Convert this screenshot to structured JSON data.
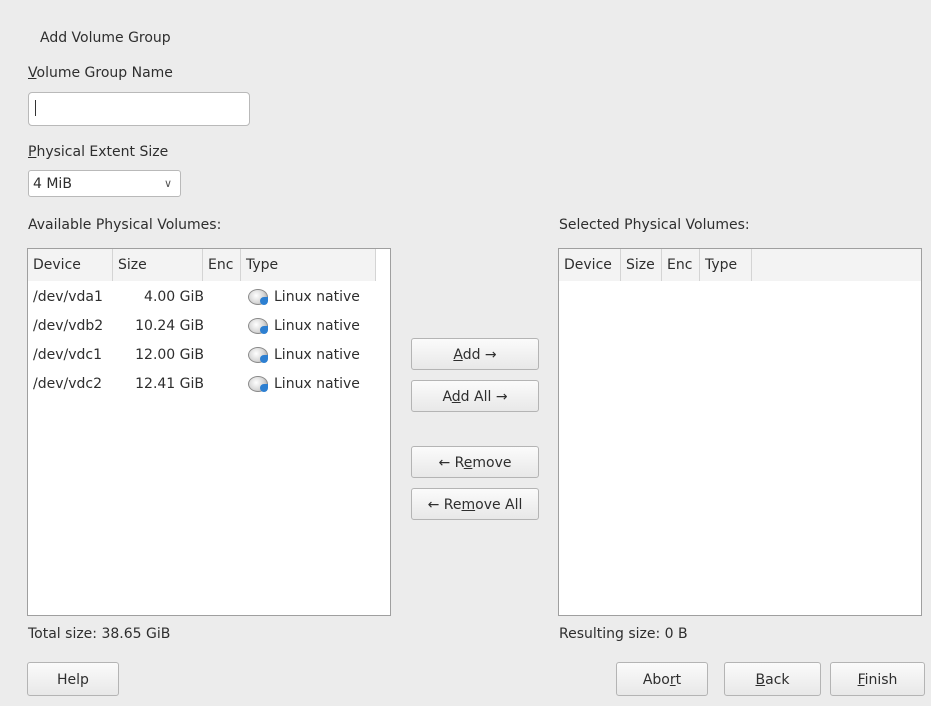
{
  "dialog": {
    "title": "Add Volume Group"
  },
  "vg_name": {
    "label_mnemonic": "V",
    "label_rest": "olume Group Name",
    "value": ""
  },
  "extent": {
    "label_mnemonic": "P",
    "label_rest": "hysical Extent Size",
    "selected": "4 MiB"
  },
  "available": {
    "label": "Available Physical Volumes:",
    "columns": [
      "Device",
      "Size",
      "Enc",
      "Type"
    ],
    "rows": [
      {
        "device": "/dev/vda1",
        "size": "4.00 GiB",
        "enc": "",
        "type": "Linux native",
        "icon": "disk-icon"
      },
      {
        "device": "/dev/vdb2",
        "size": "10.24 GiB",
        "enc": "",
        "type": "Linux native",
        "icon": "disk-icon"
      },
      {
        "device": "/dev/vdc1",
        "size": "12.00 GiB",
        "enc": "",
        "type": "Linux native",
        "icon": "disk-icon"
      },
      {
        "device": "/dev/vdc2",
        "size": "12.41 GiB",
        "enc": "",
        "type": "Linux native",
        "icon": "disk-icon"
      }
    ],
    "total": "Total size: 38.65 GiB"
  },
  "selected": {
    "label": "Selected Physical Volumes:",
    "columns": [
      "Device",
      "Size",
      "Enc",
      "Type"
    ],
    "resulting": "Resulting size: 0 B"
  },
  "middle_buttons": {
    "add": {
      "mn": "A",
      "rest": "dd →"
    },
    "add_all": {
      "pre": "A",
      "mn": "d",
      "rest": "d All →"
    },
    "remove": {
      "pre": "← R",
      "mn": "e",
      "rest": "move"
    },
    "remove_all": {
      "pre": "← Re",
      "mn": "m",
      "rest": "ove All"
    }
  },
  "footer": {
    "help": "Help",
    "abort": {
      "pre": "Abo",
      "mn": "r",
      "rest": "t"
    },
    "back": {
      "mn": "B",
      "rest": "ack"
    },
    "finish": {
      "mn": "F",
      "rest": "inish"
    }
  }
}
